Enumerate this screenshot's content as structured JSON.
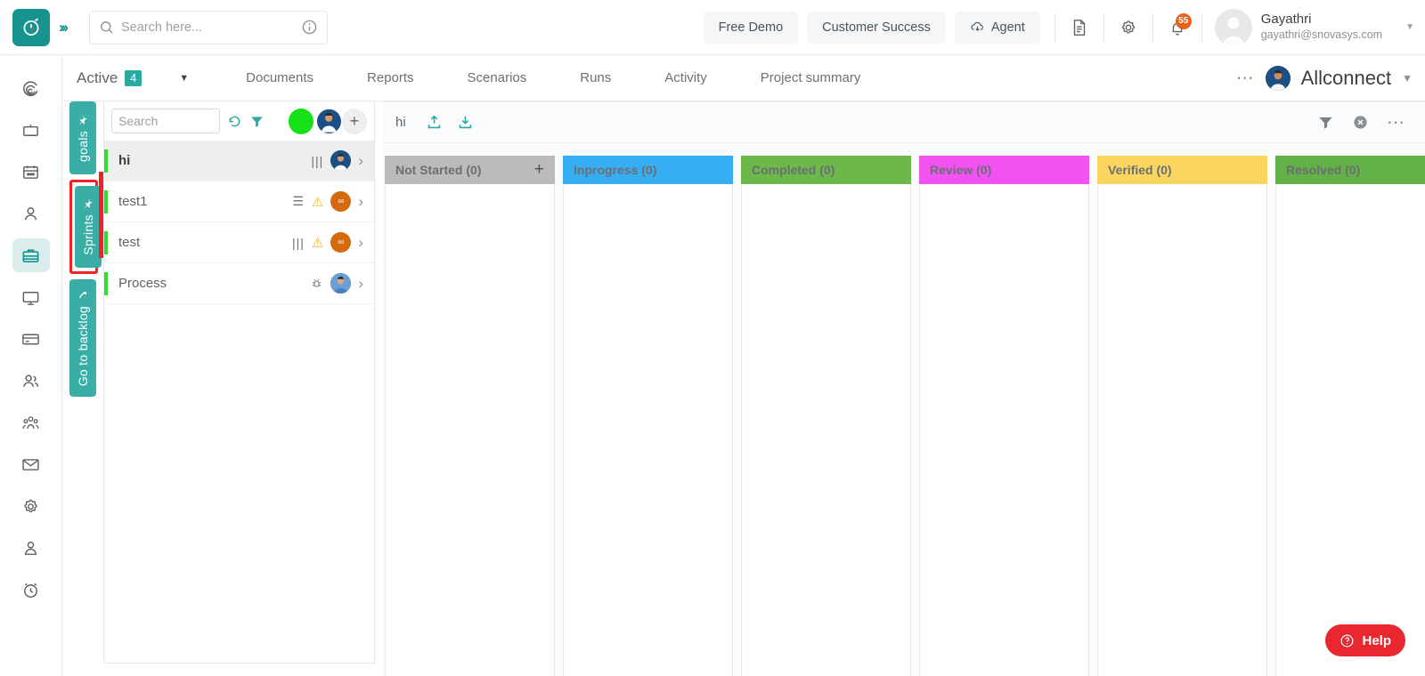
{
  "header": {
    "logo_icon": "clock-logo-icon",
    "expand_icon": "chevron-double-right-icon",
    "search": {
      "placeholder": "Search here...",
      "value": "",
      "icon": "search-icon",
      "info_icon": "info-icon"
    },
    "buttons": [
      {
        "label": "Free Demo",
        "name": "free-demo-button"
      },
      {
        "label": "Customer Success",
        "name": "customer-success-button"
      },
      {
        "label": "Agent",
        "name": "agent-button",
        "icon": "cloud-download-icon"
      }
    ],
    "doc_icon": "document-icon",
    "settings_icon": "gear-icon",
    "bell_icon": "bell-icon",
    "bell_badge": "55",
    "user": {
      "name": "Gayathri",
      "email": "gayathri@snovasys.com",
      "avatar_icon": "user-avatar",
      "caret_icon": "chevron-down-icon"
    }
  },
  "navrow": {
    "active_label": "Active",
    "active_count": "4",
    "dropdown_icon": "caret-down-icon",
    "items": [
      {
        "label": "Documents"
      },
      {
        "label": "Reports"
      },
      {
        "label": "Scenarios"
      },
      {
        "label": "Runs"
      },
      {
        "label": "Activity"
      },
      {
        "label": "Project summary"
      }
    ],
    "more_icon": "ellipsis-horizontal-icon",
    "project": {
      "name": "Allconnect",
      "avatar_icon": "project-avatar",
      "caret_icon": "chevron-down-icon"
    }
  },
  "rail": {
    "items": [
      {
        "name": "dashboard-icon",
        "active": false
      },
      {
        "name": "tv-icon",
        "active": false
      },
      {
        "name": "calendar-icon",
        "active": false
      },
      {
        "name": "user-icon",
        "active": false
      },
      {
        "name": "briefcase-icon",
        "active": true
      },
      {
        "name": "monitor-icon",
        "active": false
      },
      {
        "name": "card-icon",
        "active": false
      },
      {
        "name": "users-icon",
        "active": false
      },
      {
        "name": "team-icon",
        "active": false
      },
      {
        "name": "mail-icon",
        "active": false
      },
      {
        "name": "settings-icon",
        "active": false
      },
      {
        "name": "profile-icon",
        "active": false
      },
      {
        "name": "alarm-icon",
        "active": false
      }
    ]
  },
  "vtabs": [
    {
      "label": "goals",
      "icon": "pin-icon",
      "highlighted": false
    },
    {
      "label": "Sprints",
      "icon": "pin-icon",
      "highlighted": true
    },
    {
      "label": "Go to backlog",
      "icon": "arrow-up-icon",
      "highlighted": false
    }
  ],
  "list": {
    "search": {
      "placeholder": "Search",
      "value": ""
    },
    "refresh_icon": "refresh-icon",
    "filter_icon": "filter-icon",
    "status_dot_color": "#16e016",
    "assignee_avatar_icon": "assignee-avatar",
    "add_icon": "plus-icon",
    "rows": [
      {
        "title": "hi",
        "selected": true,
        "bar_color": "#2ee02e",
        "icons": [
          "bars-icon",
          "assignee-avatar",
          "chevron-right-icon"
        ]
      },
      {
        "title": "test1",
        "selected": false,
        "bar_color": "#2ee02e",
        "icons": [
          "list-icon",
          "warning-icon",
          "link-badge",
          "chevron-right-icon"
        ]
      },
      {
        "title": "test",
        "selected": false,
        "bar_color": "#2ee02e",
        "icons": [
          "bars-icon",
          "warning-icon",
          "link-badge",
          "chevron-right-icon"
        ]
      },
      {
        "title": "Process",
        "selected": false,
        "bar_color": "#2ee02e",
        "icons": [
          "bug-icon",
          "assignee-avatar",
          "chevron-right-icon"
        ]
      }
    ]
  },
  "board": {
    "title": "hi",
    "upload_icon": "upload-icon",
    "download_icon": "download-icon",
    "filter_icon": "filter-icon",
    "clear_icon": "clear-circle-icon",
    "more_icon": "ellipsis-horizontal-icon",
    "columns": [
      {
        "label": "Not Started (0)",
        "color": "#bbbbbb",
        "has_add": true,
        "add_icon": "plus-icon"
      },
      {
        "label": "Inprogress (0)",
        "color": "#35aef3",
        "has_add": false
      },
      {
        "label": "Completed (0)",
        "color": "#6cb84a",
        "has_add": false
      },
      {
        "label": "Review (0)",
        "color": "#f252f2",
        "has_add": false
      },
      {
        "label": "Verified (0)",
        "color": "#fbd65e",
        "has_add": false
      },
      {
        "label": "Resolved (0)",
        "color": "#63b047",
        "has_add": false
      }
    ]
  },
  "help": {
    "label": "Help",
    "icon": "question-circle-icon",
    "color": "#e9272f"
  }
}
